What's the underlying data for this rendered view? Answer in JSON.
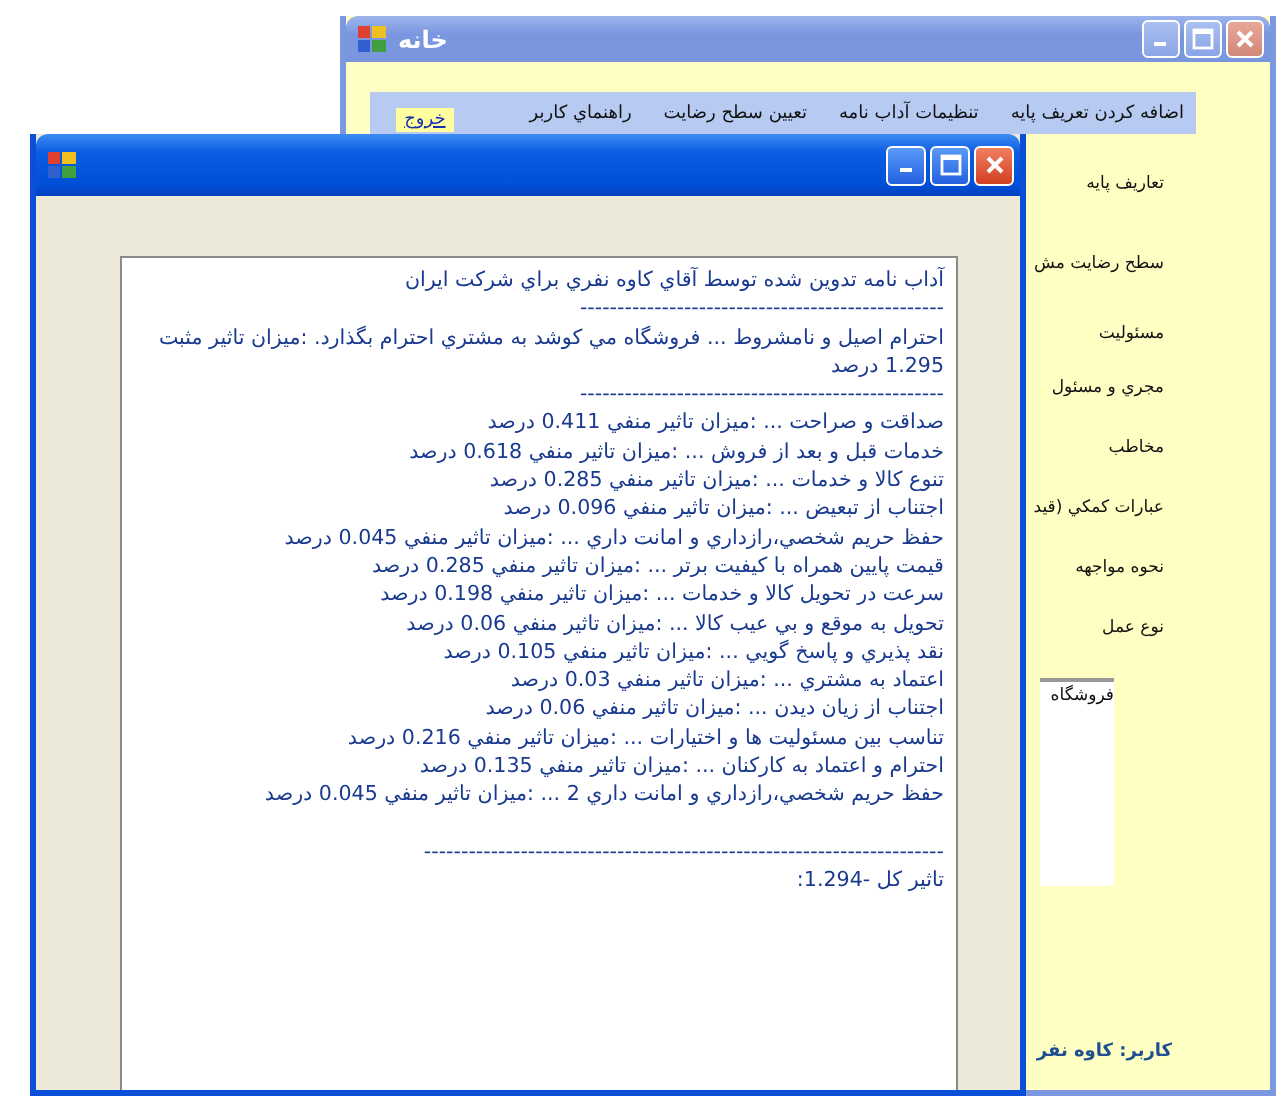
{
  "back_window": {
    "title": "خانه",
    "active": false,
    "menu": [
      {
        "label": "اضافه کردن تعريف پايه",
        "kind": "item"
      },
      {
        "label": "تنظيمات آداب نامه",
        "kind": "item"
      },
      {
        "label": "تعيين سطح رضايت",
        "kind": "item"
      },
      {
        "label": "راهنماي کاربر",
        "kind": "item"
      },
      {
        "label": "خروج",
        "kind": "link"
      }
    ],
    "labels": [
      "تعاريف پايه",
      "سطح رضايت مش",
      "مسئوليت",
      "مجري و مسئول",
      "مخاطب",
      "عبارات کمکي (قيد",
      "نحوه مواجهه",
      "نوع عمل"
    ],
    "list_items": [
      "فروشگاه"
    ],
    "user": "کاربر: کاوه نفر"
  },
  "front_window": {
    "active": true,
    "textbox": {
      "heading": "آداب نامه تدوين شده توسط آقاي کاوه نفري براي شرکت ايران",
      "rule_1": "-------------------------------------------------",
      "intro": "احترام اصيل و نامشروط ...  فروشگاه مي کوشد  به مشتري احترام بگذارد. :ميزان تاثير مثبت 1.295 درصد",
      "rule_2": "-------------------------------------------------",
      "items": [
        "صداقت و صراحت ...  :ميزان تاثير منفي 0.411 درصد",
        "خدمات قبل و بعد از فروش ...  :ميزان تاثير منفي 0.618 درصد",
        "تنوع کالا و خدمات ...  :ميزان تاثير منفي 0.285 درصد",
        "اجتناب از تبعيض ...  :ميزان تاثير منفي 0.096 درصد",
        "حفظ حريم شخصي،رازداري و امانت داري ...  :ميزان تاثير منفي 0.045 درصد",
        "قيمت پايين همراه با کيفيت برتر ...  :ميزان تاثير منفي 0.285 درصد",
        "سرعت در تحويل کالا و خدمات ...  :ميزان تاثير منفي 0.198 درصد",
        "تحويل به موقع و بي عيب کالا ...  :ميزان تاثير منفي 0.06 درصد",
        "نقد پذيري و پاسخ گويي ...  :ميزان تاثير منفي 0.105 درصد",
        "اعتماد به مشتري ...  :ميزان تاثير منفي 0.03 درصد",
        "اجتناب از زيان ديدن ...  :ميزان تاثير منفي 0.06 درصد",
        "تناسب بين مسئوليت ها و اختيارات ...  :ميزان تاثير منفي 0.216 درصد",
        "احترام و اعتماد به کارکنان ...  :ميزان تاثير منفي 0.135 درصد",
        "حفظ حريم شخصي،رازداري و امانت داري 2 ...  :ميزان تاثير منفي 0.045 درصد"
      ],
      "rule_3": "----------------------------------------------------------------------",
      "total": ":تاثير کل -1.294"
    }
  }
}
